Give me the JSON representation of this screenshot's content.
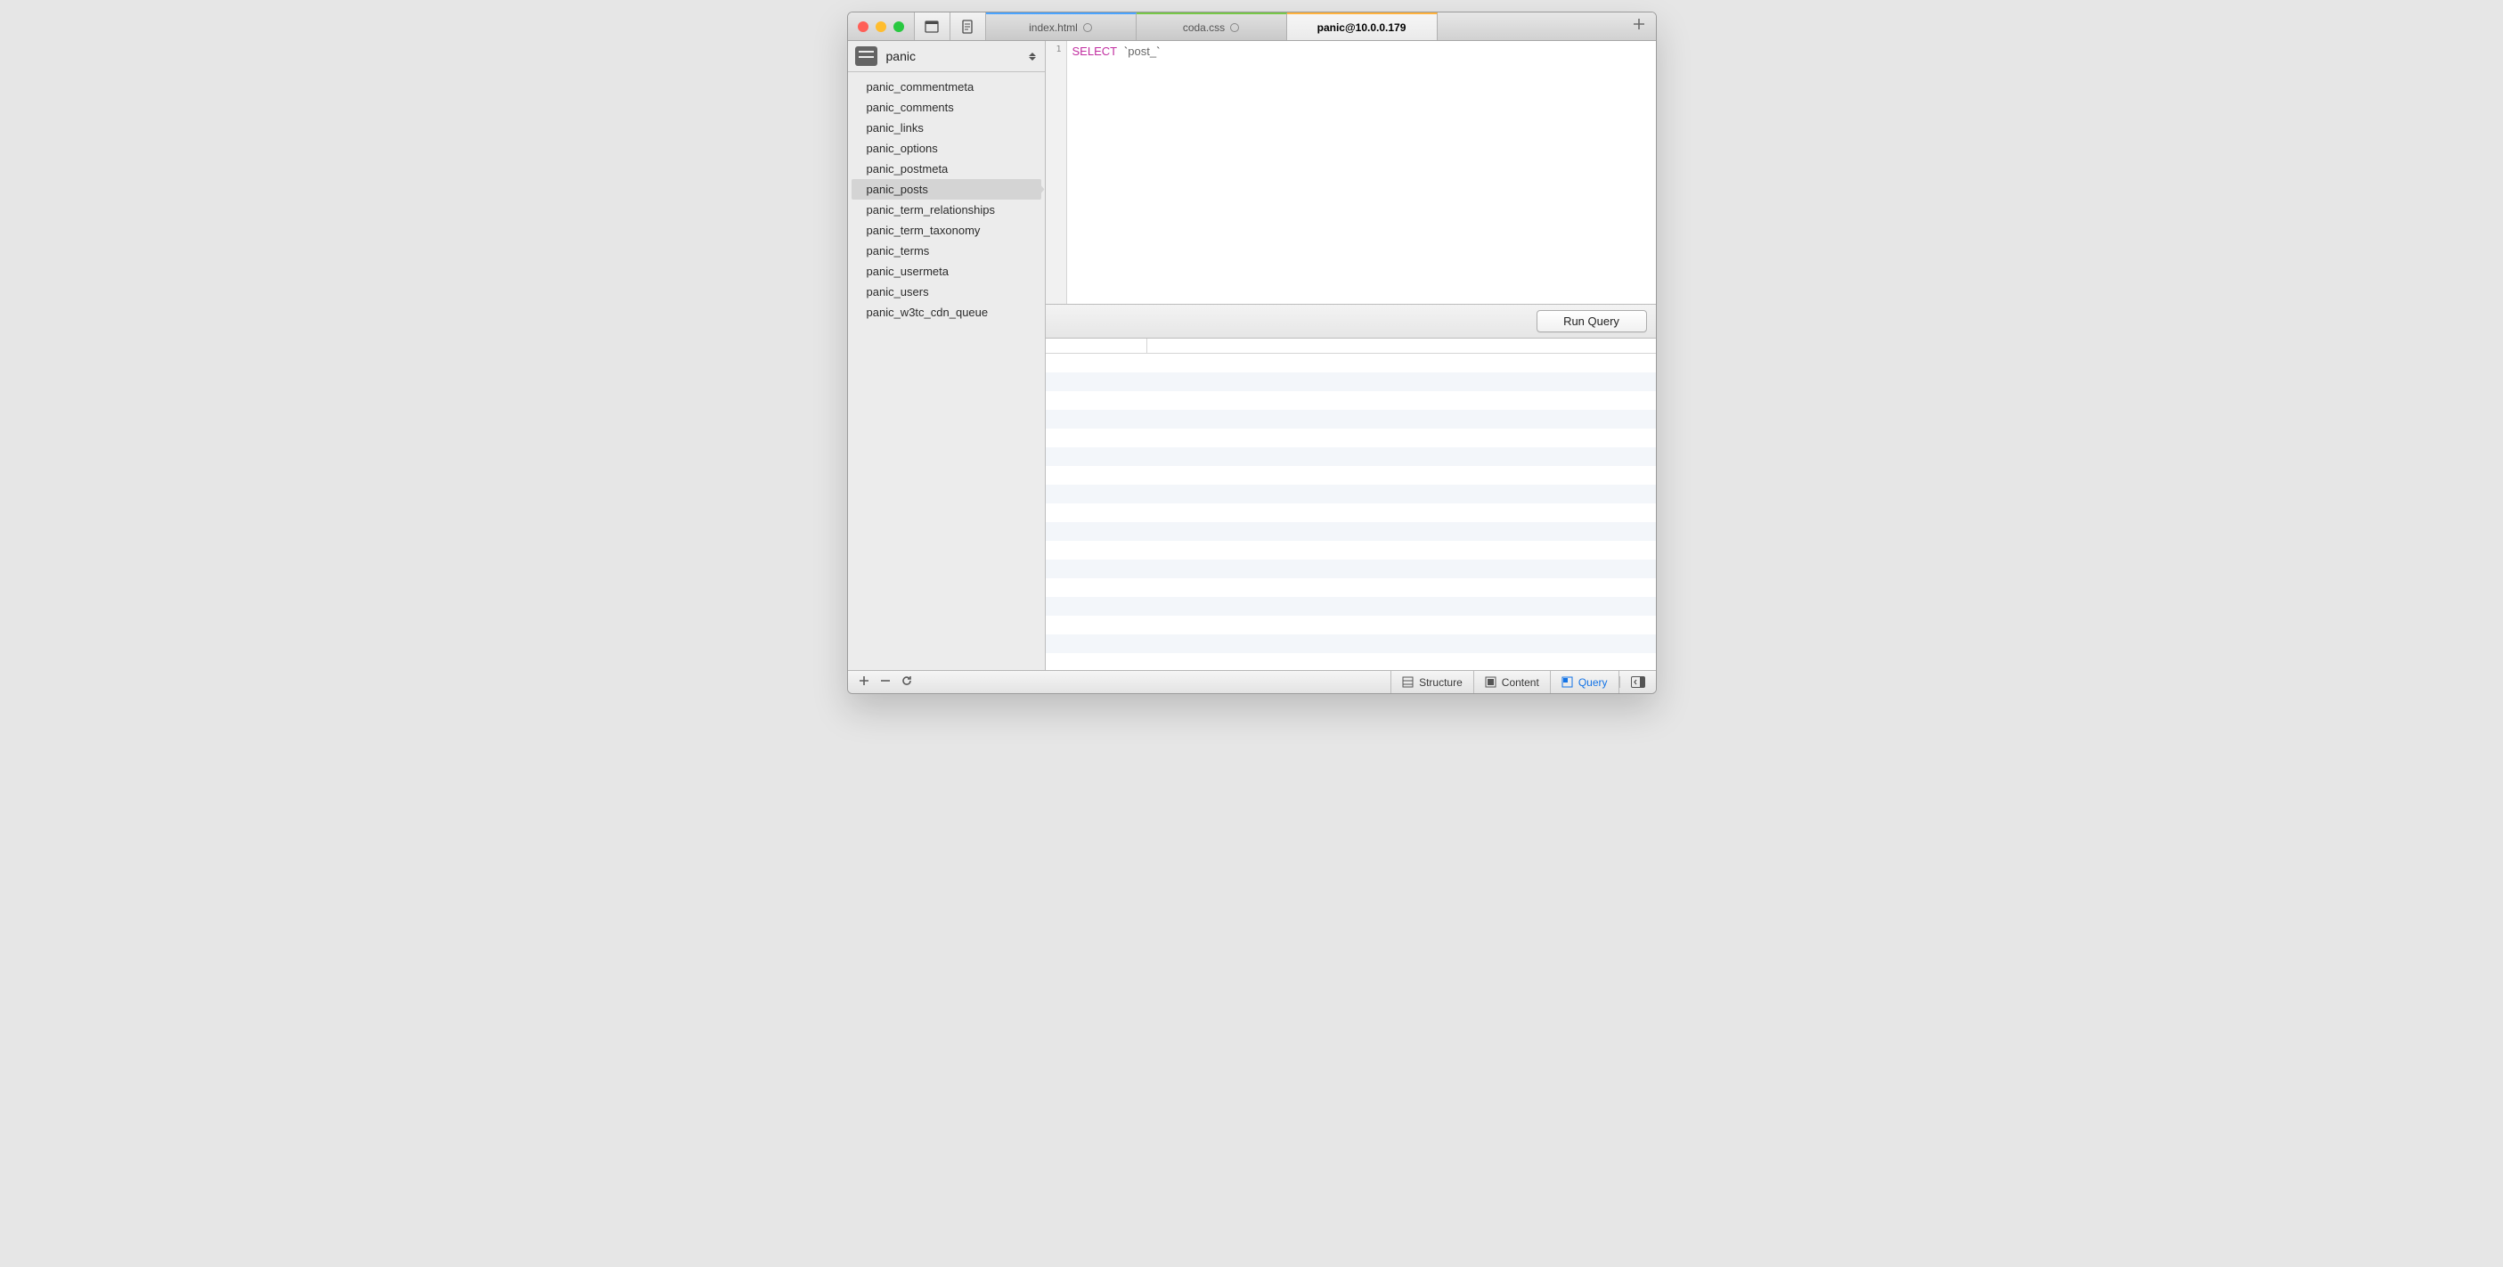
{
  "tabs": [
    {
      "label": "index.html",
      "modified": true,
      "color": "blue"
    },
    {
      "label": "coda.css",
      "modified": true,
      "color": "green"
    },
    {
      "label": "panic@10.0.0.179",
      "modified": false,
      "color": "orange",
      "active": true
    }
  ],
  "sidebar": {
    "database": "panic",
    "tables": [
      "panic_commentmeta",
      "panic_comments",
      "panic_links",
      "panic_options",
      "panic_postmeta",
      "panic_posts",
      "panic_term_relationships",
      "panic_term_taxonomy",
      "panic_terms",
      "panic_usermeta",
      "panic_users",
      "panic_w3tc_cdn_queue"
    ],
    "selected_index": 5
  },
  "editor": {
    "line_number": "1",
    "keyword": "SELECT",
    "backtick_open": "`",
    "identifier": "post_",
    "backtick_close": "`"
  },
  "toolbar": {
    "run_label": "Run Query"
  },
  "status": {
    "structure": "Structure",
    "content": "Content",
    "query": "Query"
  },
  "results": {
    "row_count": 17
  }
}
